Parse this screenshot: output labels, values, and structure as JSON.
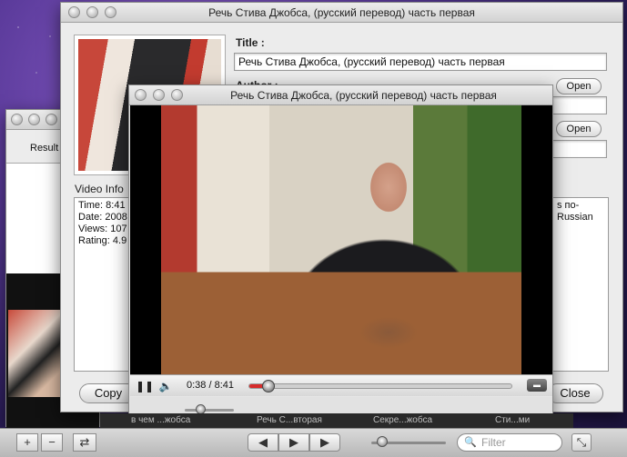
{
  "results_window": {
    "label": "Result"
  },
  "info_window": {
    "title": "Речь Стива Джобса, (русский перевод) часть первая",
    "title_label": "Title :",
    "title_value": "Речь Стива Джобса, (русский перевод) часть первая",
    "author_label": "Author :",
    "open_button_1": "Open",
    "open_button_2": "Open",
    "video_info_label": "Video Info",
    "info_lines": [
      "Time: 8:41",
      "Date: 2008",
      "Views: 107",
      "Rating: 4.9"
    ],
    "description_lines": [
      "s по-",
      "Russian"
    ],
    "copy_button": "Copy",
    "close_button": "Close"
  },
  "player_window": {
    "title": "Речь Стива Джобса, (русский перевод) часть первая",
    "time_display": "0:38 / 8:41",
    "progress": 0.073
  },
  "strip": {
    "items": [
      "в чем ...жобса",
      "Речь С...вторая",
      "Секре...жобса",
      "Сти...ми"
    ]
  },
  "toolbar": {
    "add": "+",
    "remove": "−",
    "repeat": "⇄",
    "back": "◀",
    "play": "▶",
    "forward": "▶",
    "filter_placeholder": "Filter"
  }
}
